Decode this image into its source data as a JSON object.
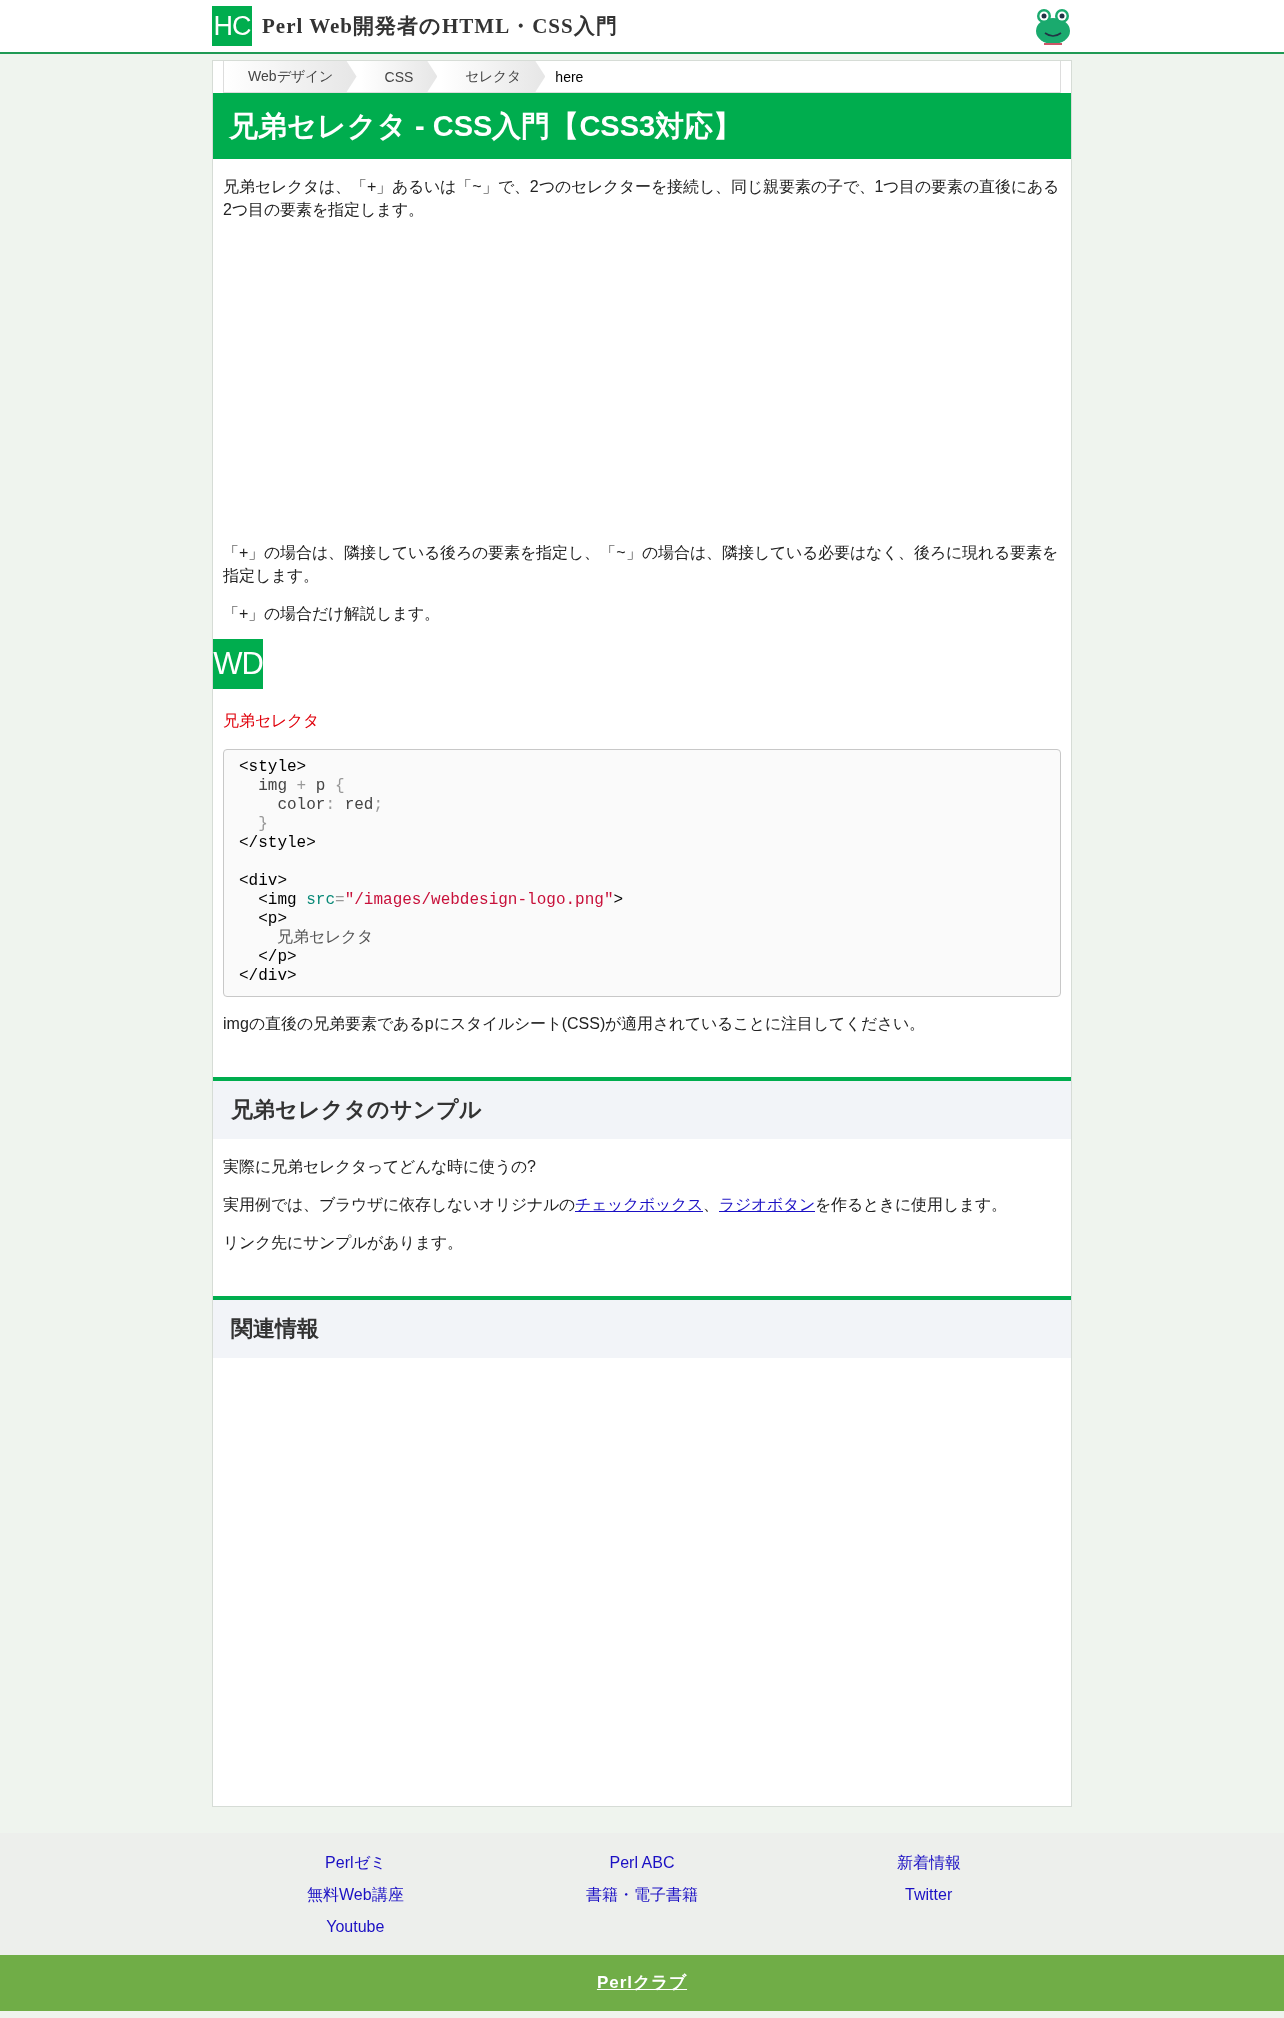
{
  "header": {
    "logo_text": "HC",
    "title": "Perl Web開発者のHTML・CSS入門"
  },
  "breadcrumb": [
    {
      "label": "Webデザイン",
      "kind": "link"
    },
    {
      "label": "CSS",
      "kind": "link"
    },
    {
      "label": "セレクタ",
      "kind": "link"
    },
    {
      "label": "here",
      "kind": "current"
    }
  ],
  "article": {
    "title": "兄弟セレクタ - CSS入門【CSS3対応】",
    "blocks": [
      {
        "kind": "paragraph",
        "parts": [
          {
            "text": "兄弟セレクタは、「+」あるいは「~」で、2つのセレクターを接続し、同じ親要素の子で、1つ目の要素の直後にある2つ目の要素を指定します。"
          }
        ]
      },
      {
        "kind": "ad-space"
      },
      {
        "kind": "paragraph",
        "parts": [
          {
            "text": "「+」の場合は、隣接している後ろの要素を指定し、「~」の場合は、隣接している必要はなく、後ろに現れる要素を指定します。"
          }
        ]
      },
      {
        "kind": "paragraph",
        "parts": [
          {
            "text": "「+」の場合だけ解説します。"
          }
        ]
      },
      {
        "kind": "logo",
        "text": "WD"
      },
      {
        "kind": "caption",
        "text": "兄弟セレクタ"
      },
      {
        "kind": "code",
        "lines": [
          {
            "kind": "code",
            "tokens": [
              {
                "kind": "tag",
                "text": "<style>"
              }
            ]
          },
          {
            "kind": "code",
            "tokens": [
              {
                "kind": "sel",
                "text": "  img "
              },
              {
                "kind": "punct",
                "text": "+"
              },
              {
                "kind": "sel",
                "text": " p "
              },
              {
                "kind": "punct",
                "text": "{"
              }
            ]
          },
          {
            "kind": "code",
            "tokens": [
              {
                "kind": "sel",
                "text": "    color"
              },
              {
                "kind": "punct",
                "text": ":"
              },
              {
                "kind": "sel",
                "text": " red"
              },
              {
                "kind": "punct",
                "text": ";"
              }
            ]
          },
          {
            "kind": "code",
            "tokens": [
              {
                "kind": "punct",
                "text": "  }"
              }
            ]
          },
          {
            "kind": "code",
            "tokens": [
              {
                "kind": "tag",
                "text": "</style>"
              }
            ]
          },
          {
            "kind": "blank"
          },
          {
            "kind": "code",
            "tokens": [
              {
                "kind": "tag",
                "text": "<div>"
              }
            ]
          },
          {
            "kind": "code",
            "tokens": [
              {
                "kind": "tag",
                "text": "  <img "
              },
              {
                "kind": "attr",
                "text": "src"
              },
              {
                "kind": "punct",
                "text": "="
              },
              {
                "kind": "string",
                "text": "\"/images/webdesign-logo.png\""
              },
              {
                "kind": "tag",
                "text": ">"
              }
            ]
          },
          {
            "kind": "code",
            "tokens": [
              {
                "kind": "tag",
                "text": "  <p>"
              }
            ]
          },
          {
            "kind": "code",
            "tokens": [
              {
                "kind": "text",
                "text": "    兄弟セレクタ"
              }
            ]
          },
          {
            "kind": "code",
            "tokens": [
              {
                "kind": "tag",
                "text": "  </p>"
              }
            ]
          },
          {
            "kind": "code",
            "tokens": [
              {
                "kind": "tag",
                "text": "</div>"
              }
            ]
          }
        ]
      },
      {
        "kind": "paragraph",
        "parts": [
          {
            "text": "imgの直後の兄弟要素であるpにスタイルシート(CSS)が適用されていることに注目してください。"
          }
        ]
      },
      {
        "kind": "section",
        "title": "兄弟セレクタのサンプル"
      },
      {
        "kind": "paragraph",
        "parts": [
          {
            "text": "実際に兄弟セレクタってどんな時に使うの?"
          }
        ]
      },
      {
        "kind": "paragraph",
        "parts": [
          {
            "text": "実用例では、ブラウザに依存しないオリジナルの"
          },
          {
            "text": "チェックボックス",
            "kind": "link"
          },
          {
            "text": "、"
          },
          {
            "text": "ラジオボタン",
            "kind": "link"
          },
          {
            "text": "を作るときに使用します。"
          }
        ]
      },
      {
        "kind": "paragraph",
        "parts": [
          {
            "text": "リンク先にサンプルがあります。"
          }
        ]
      },
      {
        "kind": "section",
        "title": "関連情報"
      },
      {
        "kind": "ad-space-large"
      }
    ]
  },
  "footer": {
    "columns": [
      [
        "Perlゼミ",
        "無料Web講座",
        "Youtube"
      ],
      [
        "Perl ABC",
        "書籍・電子書籍"
      ],
      [
        "新着情報",
        "Twitter"
      ]
    ],
    "bottom_link": "Perlクラブ"
  }
}
